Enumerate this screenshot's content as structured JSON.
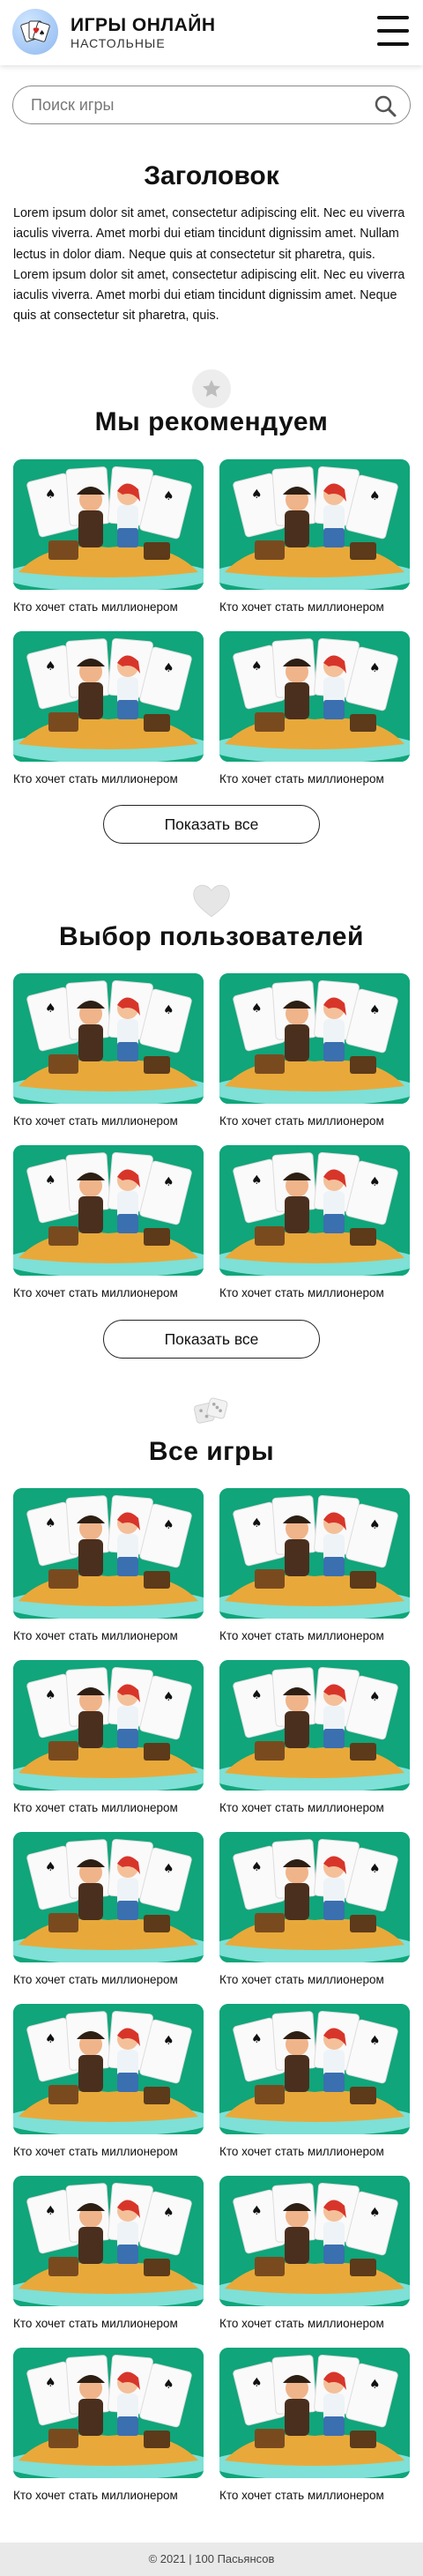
{
  "header": {
    "brand_title": "ИГРЫ ОНЛАЙН",
    "brand_subtitle": "НАСТОЛЬНЫЕ"
  },
  "search": {
    "placeholder": "Поиск игры",
    "value": ""
  },
  "intro": {
    "title": "Заголовок",
    "text": "Lorem ipsum dolor sit amet, consectetur adipiscing elit. Nec eu viverra iaculis viverra. Amet morbi dui etiam tincidunt dignissim amet. Nullam lectus in dolor diam. Neque quis at consectetur sit pharetra, quis. Lorem ipsum dolor sit amet, consectetur adipiscing elit. Nec eu viverra iaculis viverra. Amet morbi dui etiam tincidunt dignissim amet. Neque quis at consectetur sit pharetra, quis."
  },
  "sections": [
    {
      "title": "Мы рекомендуем",
      "icon": "star-icon",
      "button_label": "Показать все",
      "cards": [
        "Кто хочет стать миллионером",
        "Кто хочет стать миллионером",
        "Кто хочет стать миллионером",
        "Кто хочет стать миллионером"
      ]
    },
    {
      "title": "Выбор пользователей",
      "icon": "heart-icon",
      "button_label": "Показать все",
      "cards": [
        "Кто хочет стать миллионером",
        "Кто хочет стать миллионером",
        "Кто хочет стать миллионером",
        "Кто хочет стать миллионером"
      ]
    },
    {
      "title": "Все игры",
      "icon": "dice-icon",
      "cards": [
        "Кто хочет стать миллионером",
        "Кто хочет стать миллионером",
        "Кто хочет стать миллионером",
        "Кто хочет стать миллионером",
        "Кто хочет стать миллионером",
        "Кто хочет стать миллионером",
        "Кто хочет стать миллионером",
        "Кто хочет стать миллионером",
        "Кто хочет стать миллионером",
        "Кто хочет стать миллионером",
        "Кто хочет стать миллионером",
        "Кто хочет стать миллионером"
      ]
    }
  ],
  "footer": {
    "text": "© 2021 | 100 Пасьянсов"
  },
  "colors": {
    "thumb_bg": "#10a57a",
    "island": "#e8a93a",
    "water": "#7ee0d6"
  }
}
